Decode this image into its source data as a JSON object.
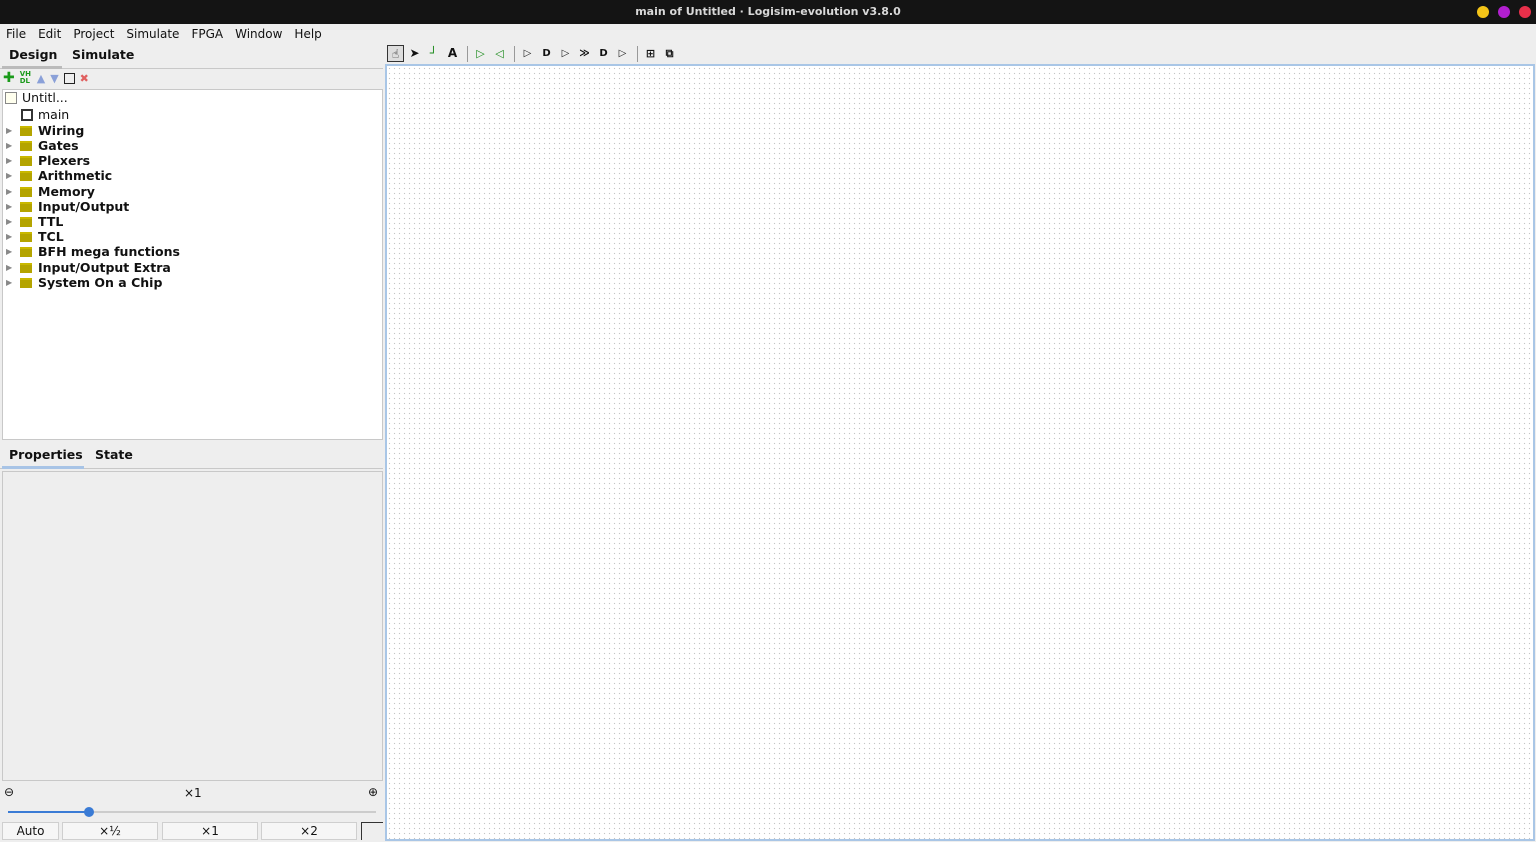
{
  "window": {
    "title": "main of Untitled · Logisim-evolution v3.8.0",
    "controls": [
      {
        "name": "minimize",
        "color": "#f5c518"
      },
      {
        "name": "maximize",
        "color": "#b21fd0"
      },
      {
        "name": "close",
        "color": "#e8304a"
      }
    ]
  },
  "menu": [
    "File",
    "Edit",
    "Project",
    "Simulate",
    "FPGA",
    "Window",
    "Help"
  ],
  "left_tabs": [
    "Design",
    "Simulate"
  ],
  "tree": {
    "root": "Untitl...",
    "circuit": "main",
    "libraries": [
      "Wiring",
      "Gates",
      "Plexers",
      "Arithmetic",
      "Memory",
      "Input/Output",
      "TTL",
      "TCL",
      "BFH mega functions",
      "Input/Output Extra",
      "System On a Chip"
    ]
  },
  "bottom_tabs": [
    "Properties",
    "State"
  ],
  "zoom": {
    "level": "×1",
    "slider_fraction": 0.22,
    "buttons": [
      "Auto",
      "×½",
      "×1",
      "×2"
    ]
  },
  "toolbar_vhdl": "VH DL"
}
